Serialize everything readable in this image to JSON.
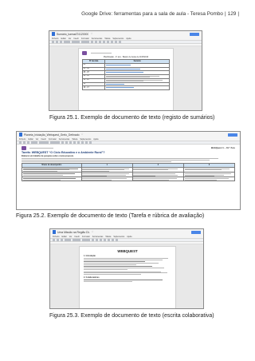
{
  "header": {
    "running_title": "Google Drive: ferramentas para a sala de aula - Teresa Pombo",
    "page_number": "129"
  },
  "figures": [
    {
      "caption": "Figura 25.1. Exemplo de documento de texto (registo de sumários)",
      "doc": {
        "title": "Sumário_turmaAT4120000",
        "menu": [
          "Ficheiro",
          "Editar",
          "Ver",
          "Inserir",
          "Formatar",
          "Ferramentas",
          "Tabela",
          "Suplementos",
          "Ajuda"
        ],
        "heading": "Planificação - 4º ano - Básico de Aulas de 2015/2016",
        "columns": [
          "Nº da Aula",
          "Sumário"
        ],
        "rows": [
          "01",
          "02 - 04",
          "05 - 07",
          "08 - 10",
          "11 - 14",
          "15",
          "16 - 17"
        ]
      }
    },
    {
      "caption": "Figura 25.2. Exemplo de documento de texto (Tarefa e rúbrica de avaliação)",
      "doc": {
        "title": "Planeta_Iniciação_Webquest_Grelo_Detinado",
        "menu": [
          "Ficheiro",
          "Editar",
          "Ver",
          "Inserir",
          "Formatar",
          "Ferramentas",
          "Tabela",
          "Suplementos",
          "Ajuda"
        ],
        "header_right": "WebQuest 1 – 10.º Ano",
        "task_title": "Tarefa: WEBQUEST “O Ciclo Educativo e o Ambiente Rural”?",
        "task_intro": "Elaborar um trabalho de pesquisa sobre o tema proposto.",
        "columns": [
          "Níveis de desempenho",
          "1",
          "2",
          "3"
        ]
      }
    },
    {
      "caption": "Figura 25.3. Exemplo de documento de texto (escrita colaborativa)",
      "doc": {
        "title": "Uma Missão na Região DL",
        "menu": [
          "Ficheiro",
          "Editar",
          "Ver",
          "Inserir",
          "Formatar",
          "Ferramentas",
          "Tabela",
          "Suplementos",
          "Ajuda"
        ],
        "logo": "WEBQUEST",
        "section_1": "1. Introdução",
        "section_2": "2. Colaboradores"
      }
    }
  ],
  "colors": {
    "accent_blue": "#4a86e8",
    "logo_purple": "#7a4f9f",
    "table_header": "#cfe2f3"
  }
}
